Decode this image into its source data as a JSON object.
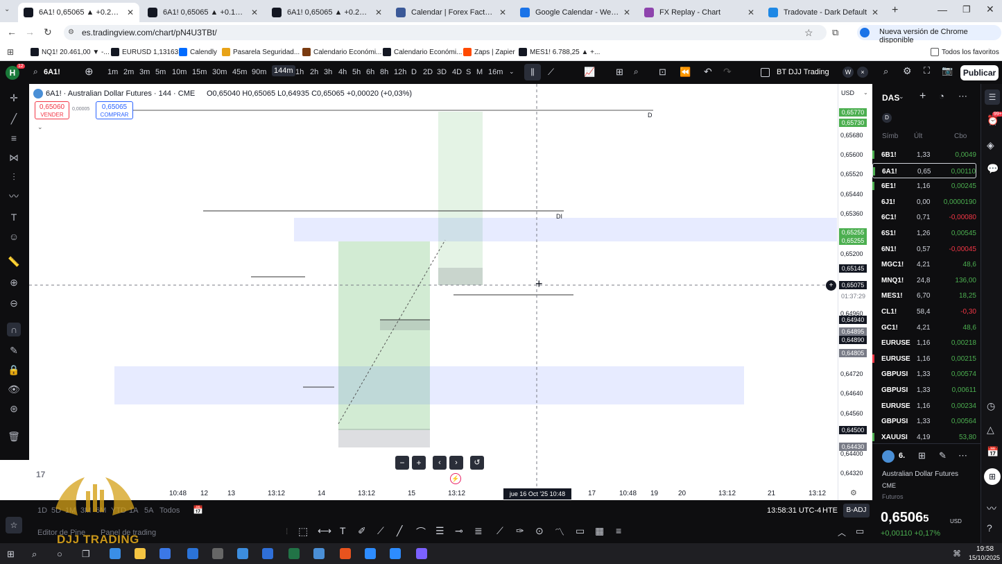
{
  "browser": {
    "tabs": [
      {
        "title": "6A1! 0,65065 ▲ +0.25% BT DJ",
        "color": "#131722",
        "active": true
      },
      {
        "title": "6A1! 0,65065 ▲ +0.17% Mento",
        "color": "#131722",
        "active": false
      },
      {
        "title": "6A1! 0,65065 ▲ +0.25% WS",
        "color": "#131722",
        "active": false
      },
      {
        "title": "Calendar | Forex Factory",
        "color": "#3b5998",
        "active": false
      },
      {
        "title": "Google Calendar - Week of Oc",
        "color": "#1a73e8",
        "active": false
      },
      {
        "title": "FX Replay - Chart",
        "color": "#8e44ad",
        "active": false
      },
      {
        "title": "Tradovate - Dark Default",
        "color": "#1e88e5",
        "active": false
      }
    ],
    "new_tab": "+",
    "url": "es.tradingview.com/chart/pN4U3TBt/",
    "chrome_update": "Nueva versión de Chrome disponible",
    "bookmarks": [
      {
        "label": "NQ1! 20.461,00 ▼ -...",
        "color": "#131722"
      },
      {
        "label": "EURUSD 1,13163",
        "color": "#131722"
      },
      {
        "label": "Calendly",
        "color": "#006bff"
      },
      {
        "label": "Pasarela Seguridad...",
        "color": "#e8a317"
      },
      {
        "label": "Calendario Económi...",
        "color": "#7a3b10"
      },
      {
        "label": "Calendario Económi...",
        "color": "#131722"
      },
      {
        "label": "Zaps | Zapier",
        "color": "#ff4a00"
      },
      {
        "label": "MES1! 6.788,25 ▲ +...",
        "color": "#131722"
      }
    ],
    "all_bookmarks": "Todos los favoritos"
  },
  "toolbar": {
    "badge": "12",
    "symbol": "6A1!",
    "timeframes": [
      "1m",
      "2m",
      "3m",
      "5m",
      "10m",
      "15m",
      "30m",
      "45m",
      "90m",
      "144m",
      "1h",
      "2h",
      "3h",
      "4h",
      "5h",
      "6h",
      "8h",
      "12h",
      "D",
      "2D",
      "3D",
      "4D",
      "S",
      "M",
      "16m"
    ],
    "active_timeframe": "144m",
    "layout_name": "BT DJJ Trading",
    "publish": "Publicar"
  },
  "chart": {
    "legend": "6A1! · Australian Dollar Futures · 144 · CME",
    "ohlc": "O0,65040 H0,65065 L0,64935 C0,65065 +0,00020 (+0,03%)",
    "sell_price": "0,65060",
    "sell_label": "VENDER",
    "buy_price": "0,65065",
    "buy_label": "COMPRAR",
    "spread": "0,00005",
    "currency": "USD",
    "label_d": "D",
    "label_di": "DI",
    "price_ticks": [
      "0,65680",
      "0,65600",
      "0,65520",
      "0,65440",
      "0,65360",
      "0,65200",
      "0,64960",
      "0,64720",
      "0,64640",
      "0,64560",
      "0,64400",
      "0,64320"
    ],
    "price_tags": [
      {
        "text": "0,65770",
        "color": "#4caf50"
      },
      {
        "text": "0,65730",
        "color": "#4caf50"
      },
      {
        "text": "0,65255",
        "color": "#4caf50"
      },
      {
        "text": "0,65255",
        "color": "#4caf50"
      },
      {
        "text": "0,65145",
        "color": "#131722"
      },
      {
        "text": "0,65075",
        "color": "#131722"
      },
      {
        "text": "0,64940",
        "color": "#131722"
      },
      {
        "text": "0,64895",
        "color": "#787b86"
      },
      {
        "text": "0,64890",
        "color": "#131722"
      },
      {
        "text": "0,64805",
        "color": "#787b86"
      },
      {
        "text": "0,64500",
        "color": "#131722"
      },
      {
        "text": "0,64430",
        "color": "#787b86"
      }
    ],
    "countdown": "01:37:29",
    "time_ticks": [
      "10:48",
      "12",
      "13",
      "13:12",
      "14",
      "13:12",
      "15",
      "13:12",
      "17",
      "10:48",
      "19",
      "20",
      "13:12",
      "21",
      "13:12"
    ],
    "crosshair_time": "jue 16 Oct '25   10:48",
    "tv_logo": "17"
  },
  "bottom": {
    "ranges": [
      "1D",
      "5D",
      "1M",
      "3M",
      "6M",
      "YTD",
      "1A",
      "5A",
      "Todos"
    ],
    "clock": "13:58:31 UTC-4",
    "session": "HTE",
    "adj": "B-ADJ",
    "pine_editor": "Editor de Pine",
    "panel": "Panel de trading"
  },
  "watchlist": {
    "title": "DAS",
    "columns": [
      "Símb",
      "Últ",
      "Cbo"
    ],
    "rows": [
      {
        "sym": "6B1!",
        "last": "1,33",
        "chg": "0,0049",
        "pos": true,
        "flag": "#4caf50"
      },
      {
        "sym": "6A1!",
        "last": "0,65",
        "chg": "0,00110",
        "pos": true,
        "flag": "#4caf50"
      },
      {
        "sym": "6E1!",
        "last": "1,16",
        "chg": "0,00245",
        "pos": true,
        "flag": "#4caf50"
      },
      {
        "sym": "6J1!",
        "last": "0,00",
        "chg": "0,0000190",
        "pos": true,
        "flag": ""
      },
      {
        "sym": "6C1!",
        "last": "0,71",
        "chg": "-0,00080",
        "pos": false,
        "flag": ""
      },
      {
        "sym": "6S1!",
        "last": "1,26",
        "chg": "0,00545",
        "pos": true,
        "flag": ""
      },
      {
        "sym": "6N1!",
        "last": "0,57",
        "chg": "-0,00045",
        "pos": false,
        "flag": ""
      },
      {
        "sym": "MGC1!",
        "last": "4,21",
        "chg": "48,6",
        "pos": true,
        "flag": ""
      },
      {
        "sym": "MNQ1!",
        "last": "24,8",
        "chg": "136,00",
        "pos": true,
        "flag": ""
      },
      {
        "sym": "MES1!",
        "last": "6,70",
        "chg": "18,25",
        "pos": true,
        "flag": ""
      },
      {
        "sym": "CL1!",
        "last": "58,4",
        "chg": "-0,30",
        "pos": false,
        "flag": ""
      },
      {
        "sym": "GC1!",
        "last": "4,21",
        "chg": "48,6",
        "pos": true,
        "flag": ""
      },
      {
        "sym": "EURUSE",
        "last": "1,16",
        "chg": "0,00218",
        "pos": true,
        "flag": ""
      },
      {
        "sym": "EURUSE",
        "last": "1,16",
        "chg": "0,00215",
        "pos": true,
        "flag": "#f23645"
      },
      {
        "sym": "GBPUSI",
        "last": "1,33",
        "chg": "0,00574",
        "pos": true,
        "flag": ""
      },
      {
        "sym": "GBPUSI",
        "last": "1,33",
        "chg": "0,00611",
        "pos": true,
        "flag": ""
      },
      {
        "sym": "EURUSE",
        "last": "1,16",
        "chg": "0,00234",
        "pos": true,
        "flag": ""
      },
      {
        "sym": "GBPUSI",
        "last": "1,33",
        "chg": "0,00564",
        "pos": true,
        "flag": ""
      },
      {
        "sym": "XAUUSI",
        "last": "4,19",
        "chg": "53,80",
        "pos": true,
        "flag": "#4caf50"
      }
    ],
    "detail": {
      "symbol": "6.",
      "name": "Australian Dollar Futures",
      "exchange": "CME",
      "type": "Futuros",
      "price": "0,6506",
      "price_last": "5",
      "currency": "USD",
      "change": "+0,00110 +0,17%"
    }
  },
  "watermark": "DJJ TRADING",
  "taskbar": {
    "time": "19:58",
    "date": "15/10/2025"
  }
}
